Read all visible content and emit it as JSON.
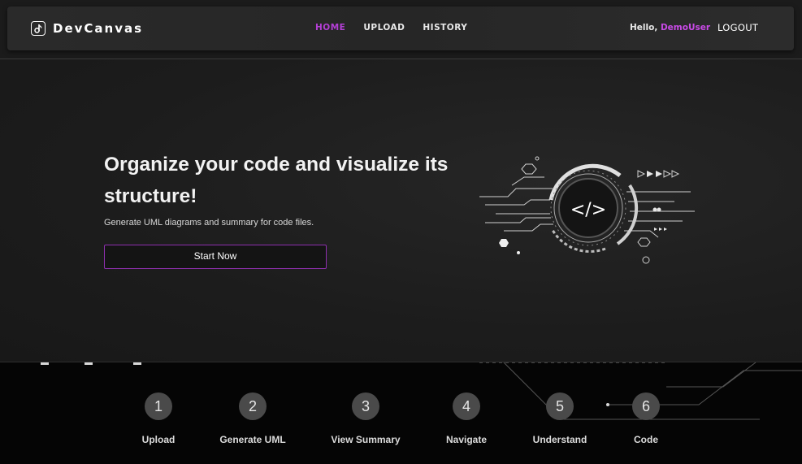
{
  "app": {
    "brand": "DevCanvas",
    "logo_icon": "code-file-logo-icon"
  },
  "nav": {
    "links": [
      {
        "label": "HOME",
        "active": true
      },
      {
        "label": "UPLOAD",
        "active": false
      },
      {
        "label": "HISTORY",
        "active": false
      }
    ],
    "greeting_prefix": "Hello, ",
    "username": "DemoUser",
    "logout_label": "LOGOUT"
  },
  "hero": {
    "title": "Organize your code and visualize its structure!",
    "subtitle": "Generate UML diagrams and summary for code files.",
    "cta_label": "Start Now",
    "illustration_text": "</>"
  },
  "steps": [
    {
      "number": "1",
      "label": "Upload"
    },
    {
      "number": "2",
      "label": "Generate UML"
    },
    {
      "number": "3",
      "label": "View Summary"
    },
    {
      "number": "4",
      "label": "Navigate"
    },
    {
      "number": "5",
      "label": "Understand"
    },
    {
      "number": "6",
      "label": "Code"
    }
  ],
  "colors": {
    "accent": "#b43fd6",
    "username": "#c84ae6",
    "button_border": "#8e2fae",
    "background": "#1b1b1b",
    "footer_bg": "#050505"
  }
}
